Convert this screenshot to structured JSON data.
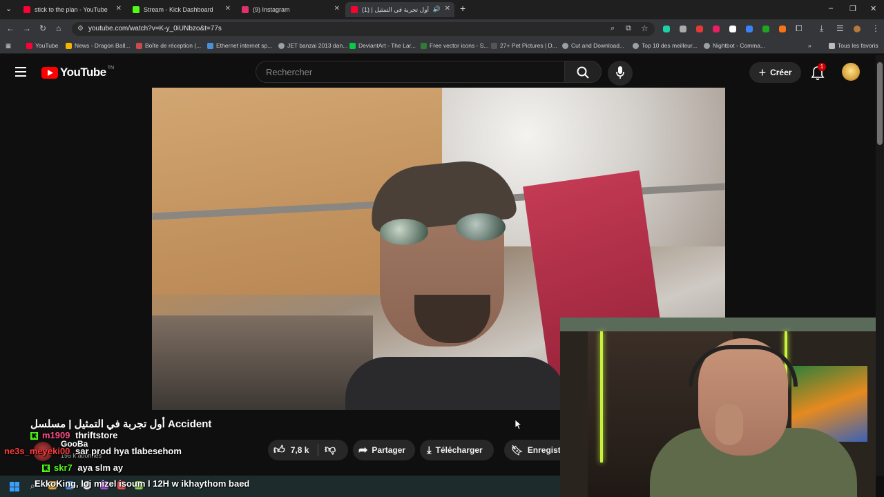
{
  "browser": {
    "tabs": [
      {
        "title": "stick to the plan - YouTube",
        "icon": "youtube-icon",
        "color": "#ff0033"
      },
      {
        "title": "Stream - Kick Dashboard",
        "icon": "kick-icon",
        "color": "#53fc18"
      },
      {
        "title": "(9) Instagram",
        "icon": "instagram-icon",
        "color": "#e1306c"
      },
      {
        "title": "أول تجربة في التمثيل | (1)",
        "icon": "youtube-icon",
        "color": "#ff0033"
      }
    ],
    "url": "youtube.com/watch?v=K-y_0iUNbzo&t=77s",
    "bookmarks": [
      "YouTube",
      "News - Dragon Ball...",
      "Boîte de réception (...",
      "Ethernet internet sp...",
      "JET banzai 2013 dan...",
      "DeviantArt - The Lar...",
      "Free vector icons - S...",
      "27+ Pet Pictures | D...",
      "Cut and Download...",
      "Top 10 des meilleur...",
      "Nightbot - Comma..."
    ],
    "all_bookmarks": "Tous les favoris"
  },
  "youtube": {
    "logo_text": "YouTube",
    "logo_region": "TN",
    "search_placeholder": "Rechercher",
    "create_label": "Créer",
    "notif_count": "1",
    "video_title": "أول تجربة في التمثيل | مسلسل Accident",
    "channel_name": "GooBa",
    "subscribers": "195 k abonnés",
    "like_count": "7,8 k",
    "share_label": "Partager",
    "download_label": "Télécharger",
    "save_label": "Enregistrer"
  },
  "chat": [
    {
      "user": "m1909",
      "message": "thriftstore",
      "user_color": "#ff4d8a",
      "badge": "K"
    },
    {
      "user": "ne3s_meyeki00",
      "message": "sar prod hya tlabesehom",
      "user_color": "#ff3b3b",
      "badge": ""
    },
    {
      "user": "skr7",
      "message": "aya slm ay",
      "user_color": "#53fc18",
      "badge": "K"
    },
    {
      "user": "EkkoKing",
      "message": "loj mizel isoum l 12H w ikhaythom baed",
      "user_color": "#ffffff",
      "badge": ""
    }
  ]
}
